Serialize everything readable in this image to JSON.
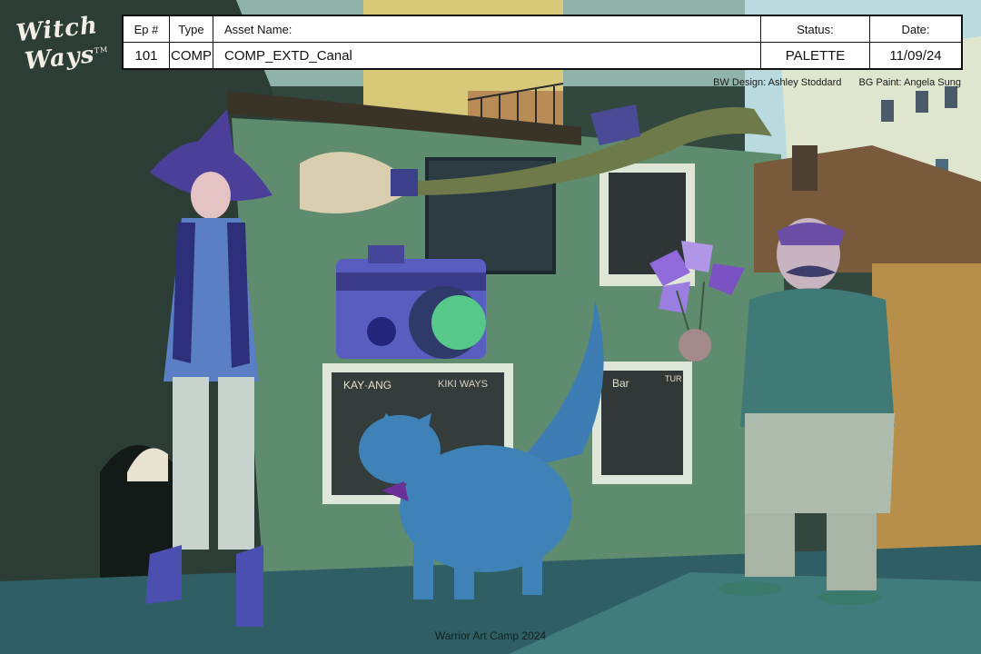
{
  "logo": {
    "line1": "Witch",
    "line2": "Ways",
    "mark": "TM"
  },
  "slate": {
    "headers": {
      "ep": "Ep #",
      "type": "Type",
      "asset": "Asset Name:",
      "status": "Status:",
      "date": "Date:"
    },
    "values": {
      "ep": "101",
      "type": "COMP",
      "asset": "COMP_EXTD_Canal",
      "status": "PALETTE",
      "date": "11/09/24"
    }
  },
  "credits": {
    "bw": "BW Design: Ashley Stoddard",
    "bg": "BG Paint: Angela Sung"
  },
  "signs": {
    "left": "KAY·ANG",
    "middle": "KIKI WAYS",
    "right_top": "Bar",
    "right_side": "TUR"
  },
  "footer": "Warrior Art Camp 2024",
  "colors": {
    "wall": "#5c8a6a",
    "sky": "#b7d7e0",
    "ground": "#2d4a4a",
    "witch_dress": "#5a7fc4",
    "hat": "#4a4aa0",
    "cat": "#3e82b8",
    "man_shirt": "#3f7a76"
  }
}
